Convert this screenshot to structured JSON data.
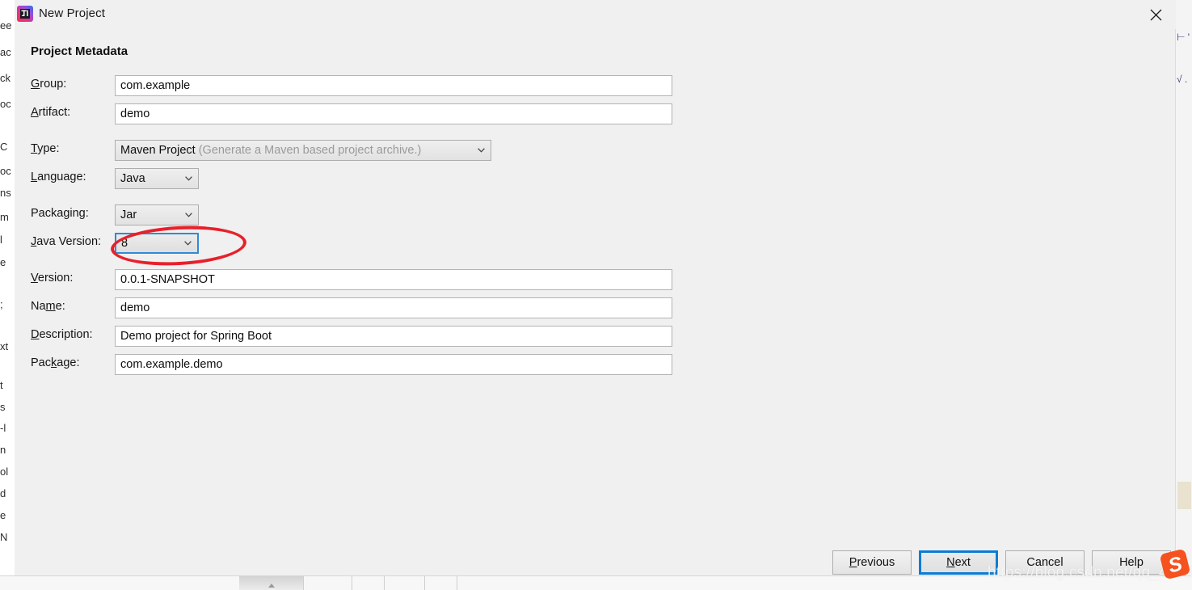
{
  "window": {
    "title": "New Project",
    "icon": "intellij-idea-icon",
    "close_label": "✕"
  },
  "section": {
    "heading": "Project Metadata"
  },
  "form": {
    "fields": [
      {
        "label": "Group:",
        "mnemonic": "G",
        "value": "com.example",
        "kind": "text"
      },
      {
        "label": "Artifact:",
        "mnemonic": "A",
        "value": "demo",
        "kind": "text"
      },
      {
        "label": "Type:",
        "mnemonic": "T",
        "value": "Maven Project",
        "hint": "(Generate a Maven based project archive.)",
        "kind": "combo"
      },
      {
        "label": "Language:",
        "mnemonic": "L",
        "value": "Java",
        "kind": "combo"
      },
      {
        "label": "Packaging:",
        "mnemonic": "g",
        "value": "Jar",
        "kind": "combo"
      },
      {
        "label": "Java Version:",
        "mnemonic": "J",
        "value": "8",
        "kind": "combo",
        "focused": true
      },
      {
        "label": "Version:",
        "mnemonic": "V",
        "value": "0.0.1-SNAPSHOT",
        "kind": "text"
      },
      {
        "label": "Name:",
        "mnemonic": "m",
        "value": "demo",
        "kind": "text"
      },
      {
        "label": "Description:",
        "mnemonic": "D",
        "value": "Demo project for Spring Boot",
        "kind": "text"
      },
      {
        "label": "Package:",
        "mnemonic": "k",
        "value": "com.example.demo",
        "kind": "text"
      }
    ]
  },
  "buttons": {
    "previous": "Previous",
    "previous_mnemonic": "P",
    "next": "Next",
    "next_mnemonic": "N",
    "cancel": "Cancel",
    "help": "Help"
  },
  "annotation": {
    "shape": "ellipse",
    "color": "#e8202a",
    "target": "java-version-combo"
  },
  "overlay": {
    "watermark": "https://blog.csdn.net/qq_40680794",
    "logo": "sogou-logo",
    "logo_letter": "S",
    "logo_color": "#f5521f"
  },
  "background": {
    "left_fragments": [
      "ee",
      "ac",
      "ck",
      "oc",
      "C",
      "oc",
      "ns",
      "m",
      "l",
      "e",
      ";",
      "xt",
      "t",
      "s",
      "-l",
      "n",
      "ol",
      "d",
      "e",
      "N"
    ],
    "right_fragments": [
      "⊢ '",
      "√ ."
    ]
  },
  "colors": {
    "accent_focus": "#0c7cd5",
    "combo_focus": "#2f8ad8",
    "annotation_red": "#e8202a",
    "dialog_bg": "#f0f0f0",
    "field_bg": "#ffffff"
  }
}
